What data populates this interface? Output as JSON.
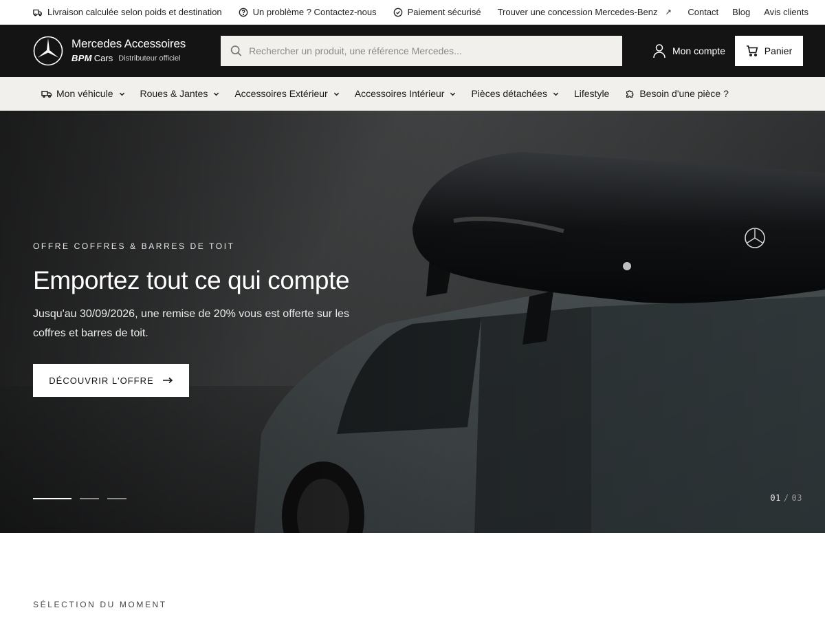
{
  "topbar": {
    "shipping": "Livraison calculée selon poids et destination",
    "problem": "Un problème ? Contactez-nous",
    "payment": "Paiement sécurisé",
    "dealer": "Trouver une concession Mercedes-Benz",
    "links": [
      "Contact",
      "Blog",
      "Avis clients"
    ]
  },
  "header": {
    "brand_title": "Mercedes Accessoires",
    "brand_bpm": "BPM",
    "brand_cars": "Cars",
    "brand_distrib": "Distributeur officiel",
    "search_placeholder": "Rechercher un produit, une référence Mercedes...",
    "account_label": "Mon compte",
    "cart_label": "Panier"
  },
  "nav": {
    "items": [
      {
        "label": "Mon véhicule"
      },
      {
        "label": "Roues & Jantes"
      },
      {
        "label": "Accessoires Extérieur"
      },
      {
        "label": "Accessoires Intérieur"
      },
      {
        "label": "Pièces détachées"
      },
      {
        "label": "Lifestyle"
      },
      {
        "label": "Besoin d'une pièce ?"
      }
    ]
  },
  "hero": {
    "eyebrow": "OFFRE COFFRES & BARRES DE TOIT",
    "title": "Emportez tout ce qui compte",
    "description": "Jusqu'au 30/09/2026, une remise de 20% vous est offerte sur les coffres et barres de toit.",
    "cta_label": "DÉCOUVRIR L'OFFRE",
    "slide_current": "01",
    "slide_separator": "/",
    "slide_total": "03"
  },
  "section": {
    "label": "SÉLECTION DU MOMENT"
  },
  "colors": {
    "header_bg": "#141414",
    "nav_bg": "#f1f0ec",
    "hero_bg": "#2a2c2d"
  }
}
